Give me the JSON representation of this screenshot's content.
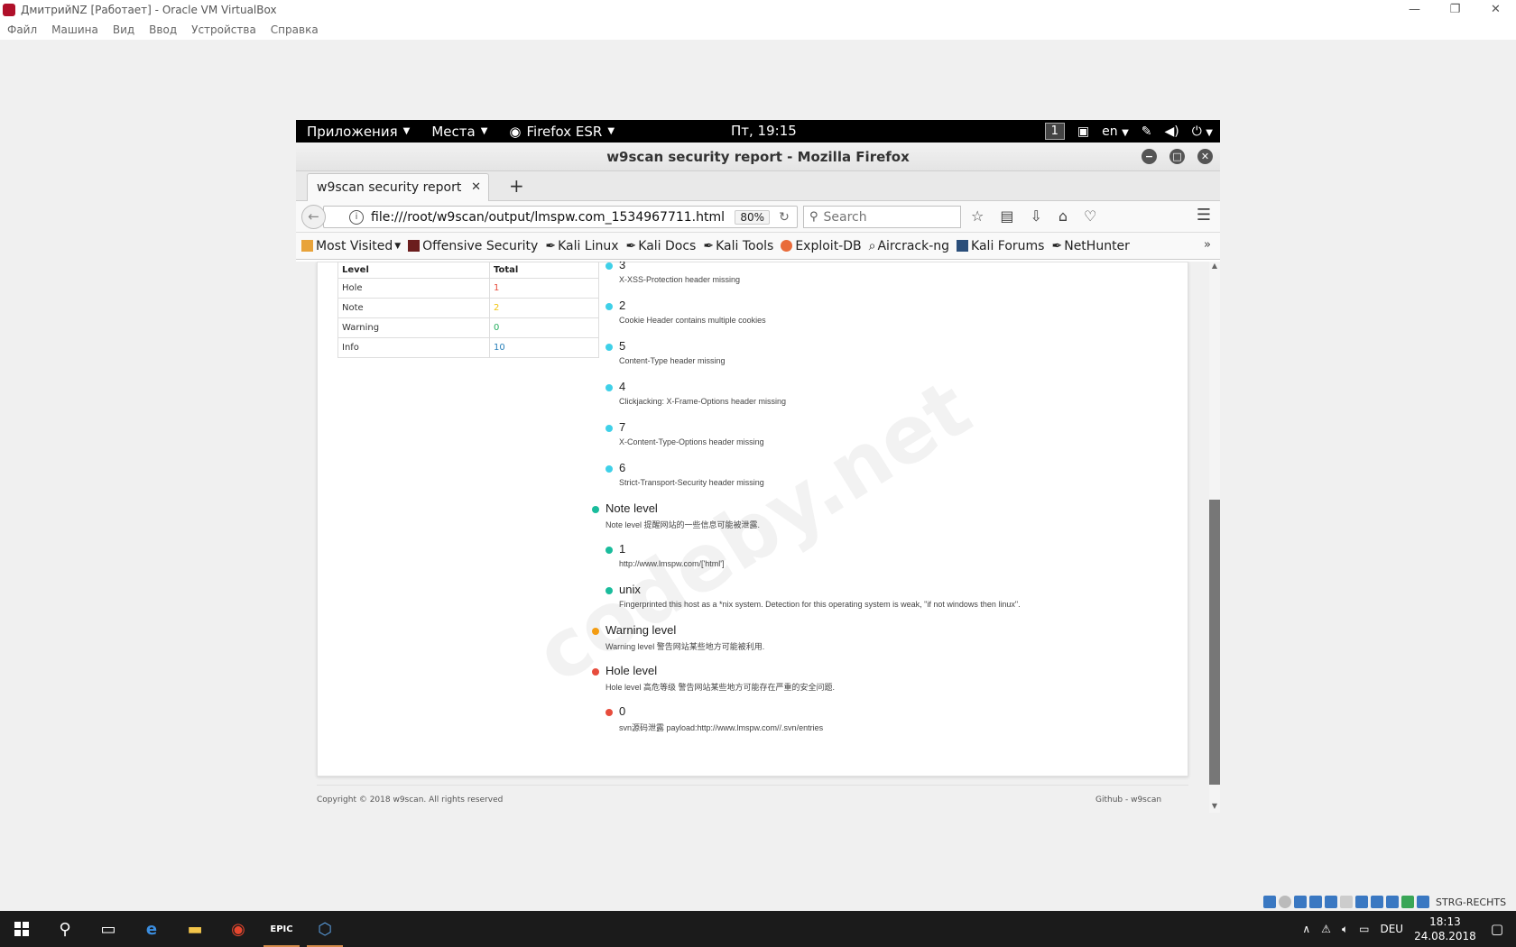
{
  "host": {
    "title": "ДмитрийNZ [Работает] - Oracle VM VirtualBox",
    "menu": [
      "Файл",
      "Машина",
      "Вид",
      "Ввод",
      "Устройства",
      "Справка"
    ],
    "controls": {
      "minimize": "—",
      "restore": "❐",
      "close": "✕"
    }
  },
  "gnome": {
    "apps": "Приложения",
    "places": "Места",
    "firefox": "Firefox ESR",
    "clock": "Пт, 19:15",
    "workspace": "1",
    "lang": "en"
  },
  "firefox": {
    "window_title": "w9scan security report - Mozilla Firefox",
    "tab_title": "w9scan security report",
    "url": "file:///root/w9scan/output/lmspw.com_1534967711.html",
    "zoom": "80%",
    "search_placeholder": "Search",
    "bookmarks": [
      "Most Visited",
      "Offensive Security",
      "Kali Linux",
      "Kali Docs",
      "Kali Tools",
      "Exploit-DB",
      "Aircrack-ng",
      "Kali Forums",
      "NetHunter"
    ]
  },
  "report": {
    "table": {
      "headers": [
        "Level",
        "Total"
      ],
      "rows": [
        {
          "level": "Hole",
          "total": "1",
          "color": "#e74c3c"
        },
        {
          "level": "Note",
          "total": "2",
          "color": "#f1c40f"
        },
        {
          "level": "Warning",
          "total": "0",
          "color": "#27ae60"
        },
        {
          "level": "Info",
          "total": "10",
          "color": "#2980b9"
        }
      ]
    },
    "items": [
      {
        "title": "3",
        "desc": "X-XSS-Protection header missing",
        "color": "#3fd0e8",
        "indent": 1
      },
      {
        "title": "2",
        "desc": "Cookie Header contains multiple cookies",
        "color": "#3fd0e8",
        "indent": 1
      },
      {
        "title": "5",
        "desc": "Content-Type header missing",
        "color": "#3fd0e8",
        "indent": 1
      },
      {
        "title": "4",
        "desc": "Clickjacking: X-Frame-Options header missing",
        "color": "#3fd0e8",
        "indent": 1
      },
      {
        "title": "7",
        "desc": "X-Content-Type-Options header missing",
        "color": "#3fd0e8",
        "indent": 1
      },
      {
        "title": "6",
        "desc": "Strict-Transport-Security header missing",
        "color": "#3fd0e8",
        "indent": 1
      },
      {
        "title": "Note level",
        "desc": "Note level 提醒网站的一些信息可能被泄露.",
        "color": "#1abc9c",
        "indent": 0
      },
      {
        "title": "1",
        "desc": "http://www.lmspw.com/['html']",
        "color": "#1abc9c",
        "indent": 1
      },
      {
        "title": "unix",
        "desc": "Fingerprinted this host as a *nix system. Detection for this operating system is weak, \"if not windows then linux\".",
        "color": "#1abc9c",
        "indent": 1
      },
      {
        "title": "Warning level",
        "desc": "Warning level 警告网站某些地方可能被利用.",
        "color": "#f39c12",
        "indent": 0
      },
      {
        "title": "Hole level",
        "desc": "Hole level 高危等级 警告网站某些地方可能存在严重的安全问题.",
        "color": "#e74c3c",
        "indent": 0
      },
      {
        "title": "0",
        "desc": "svn源码泄露 payload:http://www.lmspw.com//.svn/entries",
        "color": "#e74c3c",
        "indent": 1
      }
    ],
    "footer_left": "Copyright © 2018 w9scan. All rights reserved",
    "footer_right": "Github - w9scan",
    "watermark": "codeby.net"
  },
  "taskbar": {
    "strg": "STRG-RECHTS",
    "lang": "DEU",
    "time": "18:13",
    "date": "24.08.2018"
  }
}
